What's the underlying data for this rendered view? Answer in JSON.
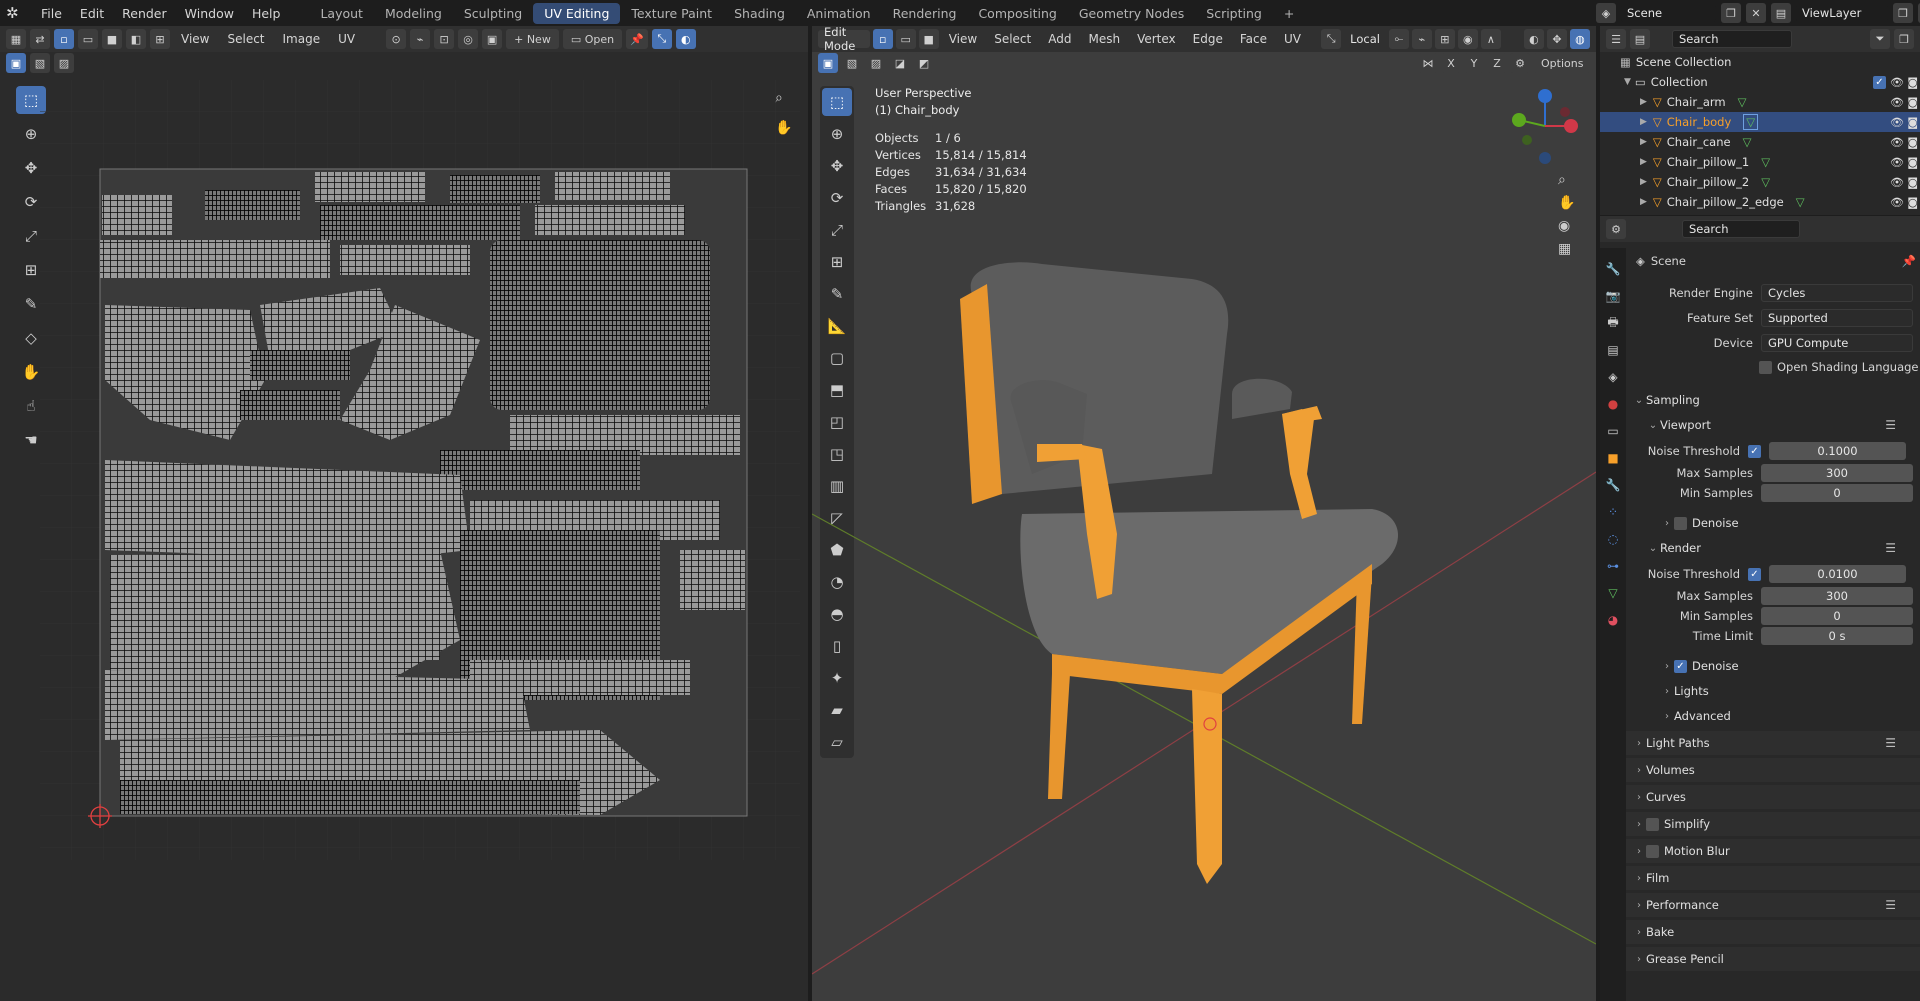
{
  "topbar": {
    "menus": [
      "File",
      "Edit",
      "Render",
      "Window",
      "Help"
    ],
    "workspaces": [
      "Layout",
      "Modeling",
      "Sculpting",
      "UV Editing",
      "Texture Paint",
      "Shading",
      "Animation",
      "Rendering",
      "Compositing",
      "Geometry Nodes",
      "Scripting"
    ],
    "active_workspace": "UV Editing",
    "add_tab": "+",
    "scene": "Scene",
    "view_layer": "ViewLayer"
  },
  "uv_editor": {
    "menus": [
      "View",
      "Select",
      "Image",
      "UV"
    ],
    "new_label": "New",
    "open_label": "Open"
  },
  "viewport": {
    "mode": "Edit Mode",
    "menus": [
      "View",
      "Select",
      "Add",
      "Mesh",
      "Vertex",
      "Edge",
      "Face",
      "UV"
    ],
    "orientation": "Local",
    "axes": [
      "X",
      "Y",
      "Z"
    ],
    "options": "Options",
    "view_name": "User Perspective",
    "object_name": "(1) Chair_body",
    "stats": [
      {
        "label": "Objects",
        "value": "1 / 6"
      },
      {
        "label": "Vertices",
        "value": "15,814 / 15,814"
      },
      {
        "label": "Edges",
        "value": "31,634 / 31,634"
      },
      {
        "label": "Faces",
        "value": "15,820 / 15,820"
      },
      {
        "label": "Triangles",
        "value": "31,628"
      }
    ]
  },
  "outliner": {
    "search_placeholder": "Search",
    "scene_collection": "Scene Collection",
    "collection": "Collection",
    "items": [
      "Chair_arm",
      "Chair_body",
      "Chair_cane",
      "Chair_pillow_1",
      "Chair_pillow_2",
      "Chair_pillow_2_edge"
    ],
    "selected": "Chair_body"
  },
  "properties": {
    "search_placeholder": "Search",
    "context": "Scene",
    "render_engine_label": "Render Engine",
    "render_engine": "Cycles",
    "feature_set_label": "Feature Set",
    "feature_set": "Supported",
    "device_label": "Device",
    "device": "GPU Compute",
    "osl_label": "Open Shading Language",
    "sampling": "Sampling",
    "viewport": "Viewport",
    "vp_noise_label": "Noise Threshold",
    "vp_noise": "0.1000",
    "vp_max_label": "Max Samples",
    "vp_max": "300",
    "vp_min_label": "Min Samples",
    "vp_min": "0",
    "denoise": "Denoise",
    "render": "Render",
    "r_noise_label": "Noise Threshold",
    "r_noise": "0.0100",
    "r_max_label": "Max Samples",
    "r_max": "300",
    "r_min_label": "Min Samples",
    "r_min": "0",
    "time_limit_label": "Time Limit",
    "time_limit": "0 s",
    "lights": "Lights",
    "advanced": "Advanced",
    "light_paths": "Light Paths",
    "volumes": "Volumes",
    "curves": "Curves",
    "simplify": "Simplify",
    "motion_blur": "Motion Blur",
    "film": "Film",
    "performance": "Performance",
    "bake": "Bake",
    "grease_pencil": "Grease Pencil"
  },
  "colors": {
    "accent": "#4772b3",
    "selected_orange": "#f7a02a",
    "active_tab": "#344c75"
  }
}
